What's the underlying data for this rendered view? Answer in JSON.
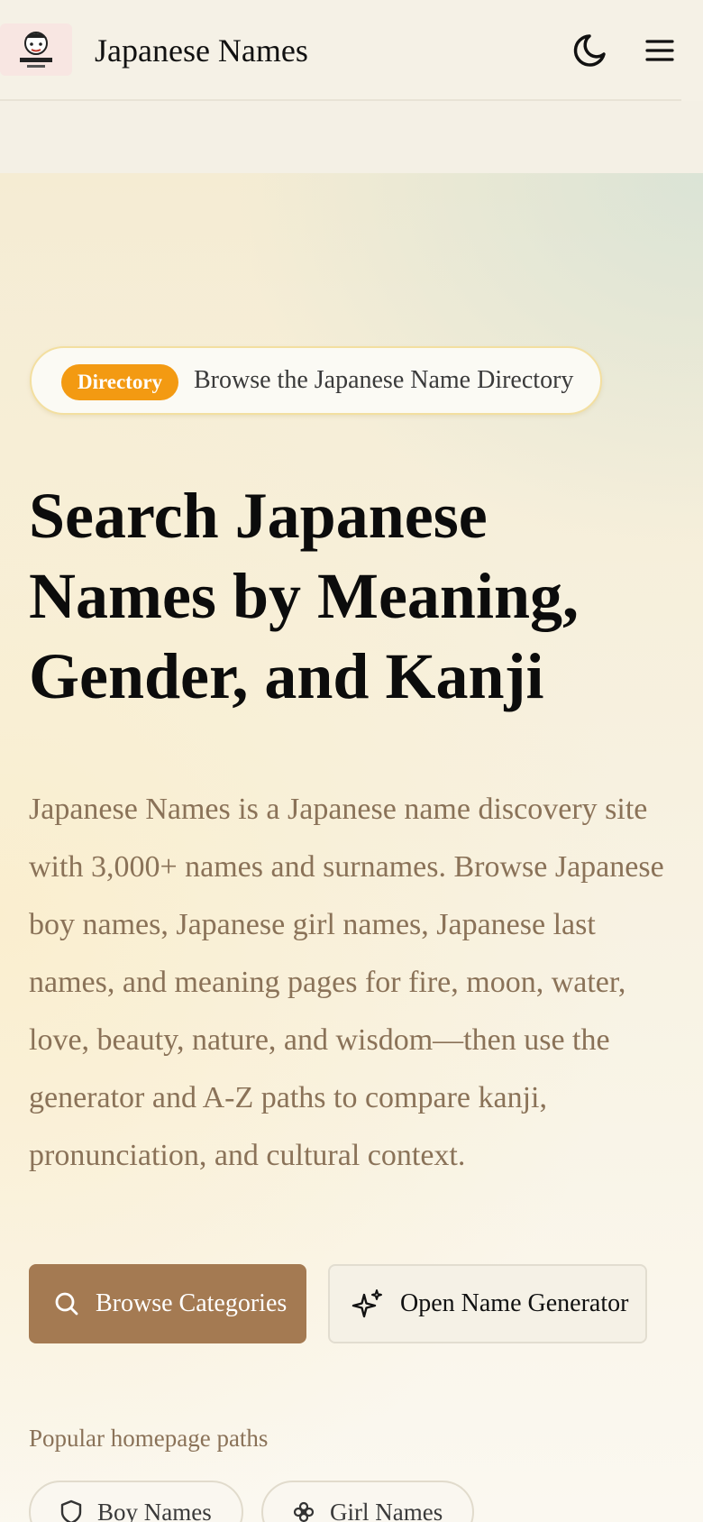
{
  "header": {
    "site_title": "Japanese Names",
    "logo_text": "JAPANESE NAMES",
    "icons": {
      "theme_toggle": "moon-icon",
      "menu": "hamburger-menu-icon"
    }
  },
  "hero": {
    "badge_label": "Directory",
    "badge_text": "Browse the Japanese Name Directory",
    "headline": "Search Japanese Names by Meaning, Gender, and Kanji",
    "intro": "Japanese Names is a Japanese name discovery site with 3,000+ names and surnames. Browse Japanese boy names, Japanese girl names, Japanese last names, and meaning pages for fire, moon, water, love, beauty, nature, and wisdom—then use the generator and A-Z paths to compare kanji, pronunciation, and cultural context.",
    "primary_button": {
      "label": "Browse Categories",
      "icon": "search-icon"
    },
    "secondary_button": {
      "label": "Open Name Generator",
      "icon": "sparkles-icon"
    },
    "paths_label": "Popular homepage paths",
    "paths": [
      {
        "label": "Boy Names",
        "icon": "shield-icon"
      },
      {
        "label": "Girl Names",
        "icon": "flower-icon"
      }
    ]
  },
  "colors": {
    "badge": "#f39a12",
    "primary_button": "#a47a52",
    "intro_text": "#8a7258"
  }
}
